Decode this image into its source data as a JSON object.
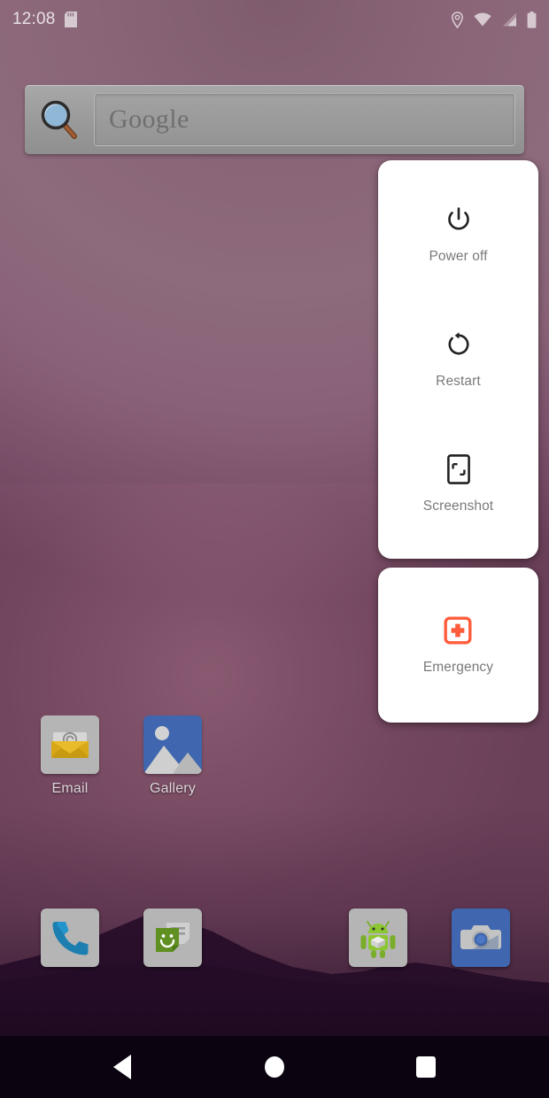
{
  "status_bar": {
    "time": "12:08",
    "icons": [
      "sd-card-icon",
      "location-icon",
      "wifi-icon",
      "cellular-signal-icon",
      "battery-icon"
    ]
  },
  "search_widget": {
    "icon": "magnifier-icon",
    "placeholder": "Google"
  },
  "power_menu": {
    "items": [
      {
        "label": "Power off",
        "icon": "power-icon"
      },
      {
        "label": "Restart",
        "icon": "restart-icon"
      },
      {
        "label": "Screenshot",
        "icon": "screenshot-icon"
      }
    ],
    "emergency": {
      "label": "Emergency",
      "icon": "emergency-cross-icon",
      "color": "#ff5c3b"
    }
  },
  "home_apps": [
    {
      "label": "Email",
      "icon": "email-icon"
    },
    {
      "label": "Gallery",
      "icon": "gallery-icon"
    }
  ],
  "dock_apps": [
    {
      "label": "Phone",
      "icon": "phone-icon"
    },
    {
      "label": "Messaging",
      "icon": "messaging-icon"
    },
    {
      "label": "Apps",
      "icon": "android-robot-icon"
    },
    {
      "label": "Camera",
      "icon": "camera-icon"
    }
  ],
  "nav_bar": {
    "back": "Back",
    "home": "Home",
    "recents": "Recents"
  },
  "colors": {
    "wallpaper_top": "#7e5b6d",
    "wallpaper_mid": "#8d6a7c",
    "mountain": "#2a0f2c",
    "nav_bar": "#0c0310",
    "menu_card": "#ffffff",
    "menu_label": "#7a7a7a",
    "emergency_accent": "#ff5c3b"
  }
}
